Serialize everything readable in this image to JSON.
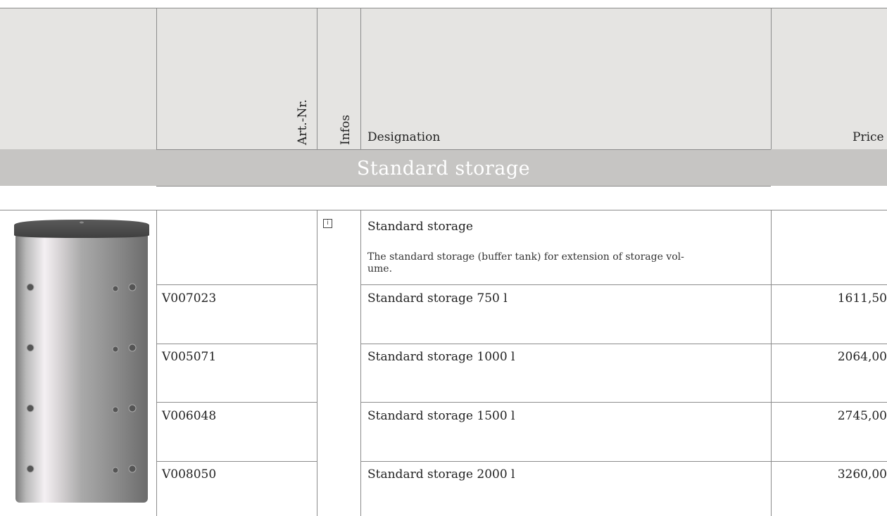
{
  "table": {
    "headers": {
      "art_nr": "Art.-Nr.",
      "infos": "Infos",
      "designation": "Designation",
      "price": "Price"
    },
    "section_title": "Standard storage",
    "product": {
      "title": "Standard storage",
      "description": "The standard storage (buffer tank) for extension of storage vol-\nume.",
      "info_icon": "info-icon"
    },
    "rows": [
      {
        "art_nr": "V007023",
        "designation": "Standard storage 750 l",
        "price": "1611,50"
      },
      {
        "art_nr": "V005071",
        "designation": "Standard storage 1000 l",
        "price": "2064,00"
      },
      {
        "art_nr": "V006048",
        "designation": "Standard storage 1500 l",
        "price": "2745,00"
      },
      {
        "art_nr": "V008050",
        "designation": "Standard storage 2000 l",
        "price": "3260,00"
      }
    ]
  }
}
